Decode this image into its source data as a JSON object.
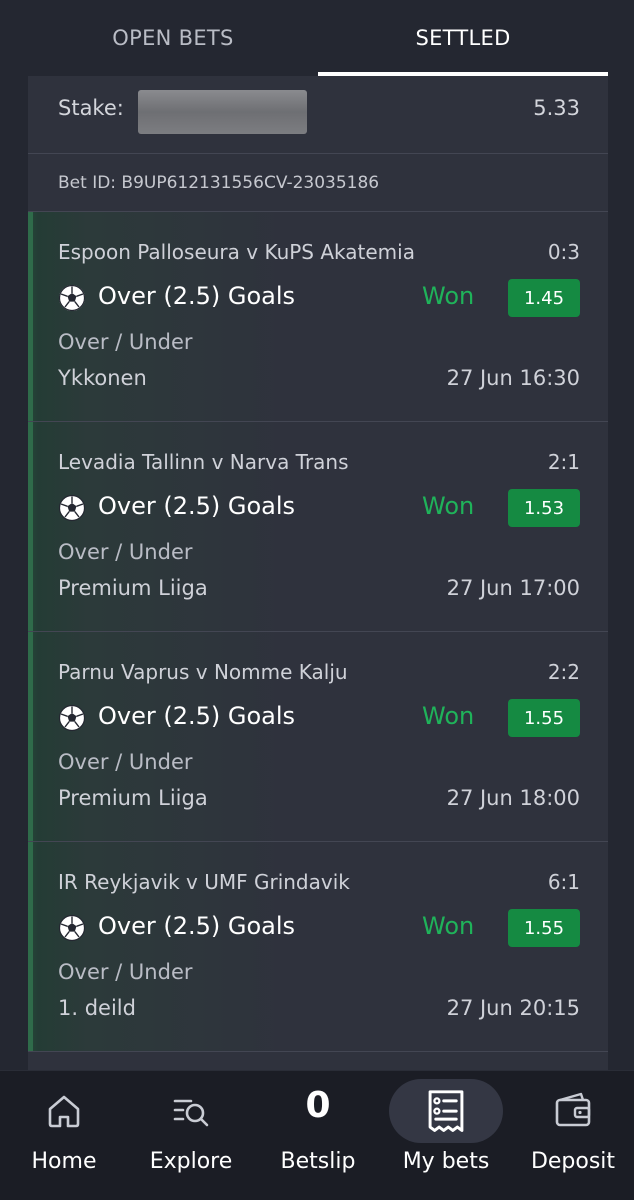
{
  "tabs": {
    "open_bets": "OPEN BETS",
    "settled": "SETTLED",
    "active": "settled"
  },
  "stake": {
    "label": "Stake:",
    "value": "5.33"
  },
  "bet": {
    "id_text": "Bet ID: B9UP612131556CV-23035186"
  },
  "legs": [
    {
      "teams": "Espoon Palloseura v KuPS Akatemia",
      "score": "0:3",
      "market": "Over (2.5) Goals",
      "status": "Won",
      "odds": "1.45",
      "type": "Over / Under",
      "league": "Ykkonen",
      "time": "27 Jun 16:30"
    },
    {
      "teams": "Levadia Tallinn v Narva Trans",
      "score": "2:1",
      "market": "Over (2.5) Goals",
      "status": "Won",
      "odds": "1.53",
      "type": "Over / Under",
      "league": "Premium Liiga",
      "time": "27 Jun 17:00"
    },
    {
      "teams": "Parnu Vaprus v Nomme Kalju",
      "score": "2:2",
      "market": "Over (2.5) Goals",
      "status": "Won",
      "odds": "1.55",
      "type": "Over / Under",
      "league": "Premium Liiga",
      "time": "27 Jun 18:00"
    },
    {
      "teams": "IR Reykjavik v UMF Grindavik",
      "score": "6:1",
      "market": "Over (2.5) Goals",
      "status": "Won",
      "odds": "1.55",
      "type": "Over / Under",
      "league": "1. deild",
      "time": "27 Jun 20:15"
    }
  ],
  "nav": {
    "home": "Home",
    "explore": "Explore",
    "betslip": "Betslip",
    "betslip_count": "0",
    "my_bets": "My bets",
    "deposit": "Deposit",
    "active": "my_bets"
  },
  "colors": {
    "background": "#242731",
    "panel": "#2f323d",
    "won": "#1fb35a",
    "odds_badge": "#158a42",
    "nav_bar": "#1b1d25"
  },
  "icons": {
    "sport": "soccer-ball-icon",
    "home": "home-icon",
    "explore": "explore-search-icon",
    "my_bets": "receipt-list-icon",
    "deposit": "wallet-icon"
  }
}
